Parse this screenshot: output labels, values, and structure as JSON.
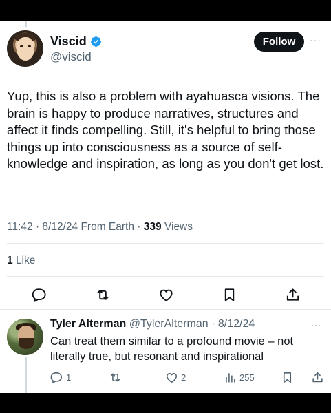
{
  "tweet": {
    "author_name": "Viscid",
    "author_handle": "@viscid",
    "follow_label": "Follow",
    "more_label": "···",
    "text": "Yup, this is also a problem with ayahuasca visions. The brain is happy to produce narratives, structures and affect it finds compelling. Still, it's helpful to bring those things up into consciousness as a source of self-knowledge and inspiration, as long as you don't get lost.",
    "time": "11:42",
    "date": "8/12/24",
    "source": "From Earth",
    "views_count": "339",
    "views_label": "Views",
    "likes_count": "1",
    "likes_label": "Like",
    "icons": [
      "reply-icon",
      "retweet-icon",
      "like-icon",
      "bookmark-icon",
      "share-icon"
    ]
  },
  "reply": {
    "author_name": "Tyler Alterman",
    "author_handle": "@TylerAlterman",
    "date": "8/12/24",
    "more_label": "···",
    "text": "Can treat them similar to a profound movie – not literally true, but resonant and inspirational",
    "reply_count": "1",
    "retweet_count": "",
    "like_count": "2",
    "views_count": "255"
  },
  "colors": {
    "accent": "#1d9bf0",
    "text": "#0f1419",
    "secondary": "#536471",
    "divider": "#e6e9ec",
    "follow_bg": "#0f1419"
  }
}
